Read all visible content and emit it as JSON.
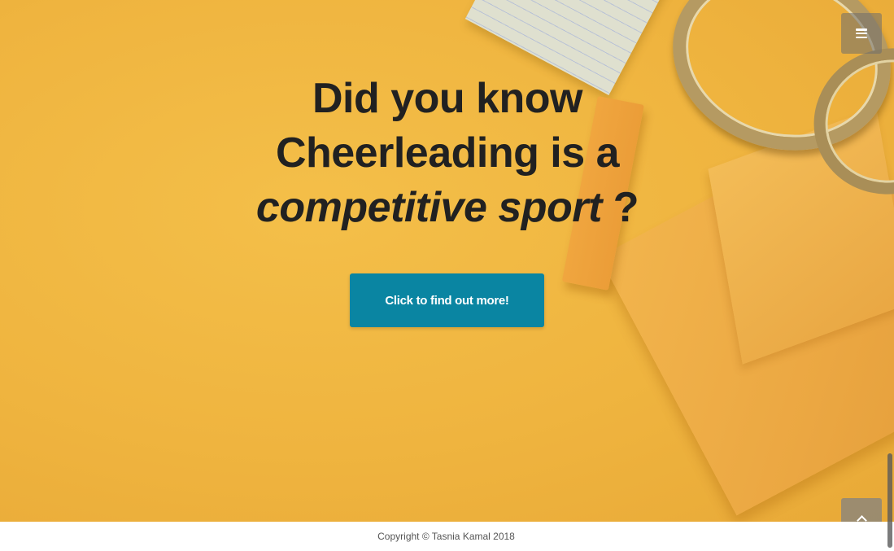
{
  "hero": {
    "headline_line1": "Did you know",
    "headline_line2": "Cheerleading is a",
    "headline_emphasis": "competitive sport",
    "headline_suffix": " ?",
    "cta_label": "Click to find out more!"
  },
  "nav": {
    "menu_icon": "hamburger-menu-icon",
    "back_to_top_icon": "chevron-up-icon"
  },
  "footer": {
    "copyright": "Copyright © Tasnia Kamal 2018"
  },
  "colors": {
    "hero_background": "#f0b743",
    "cta_background": "#0a85a2",
    "headline_text": "#212121"
  }
}
